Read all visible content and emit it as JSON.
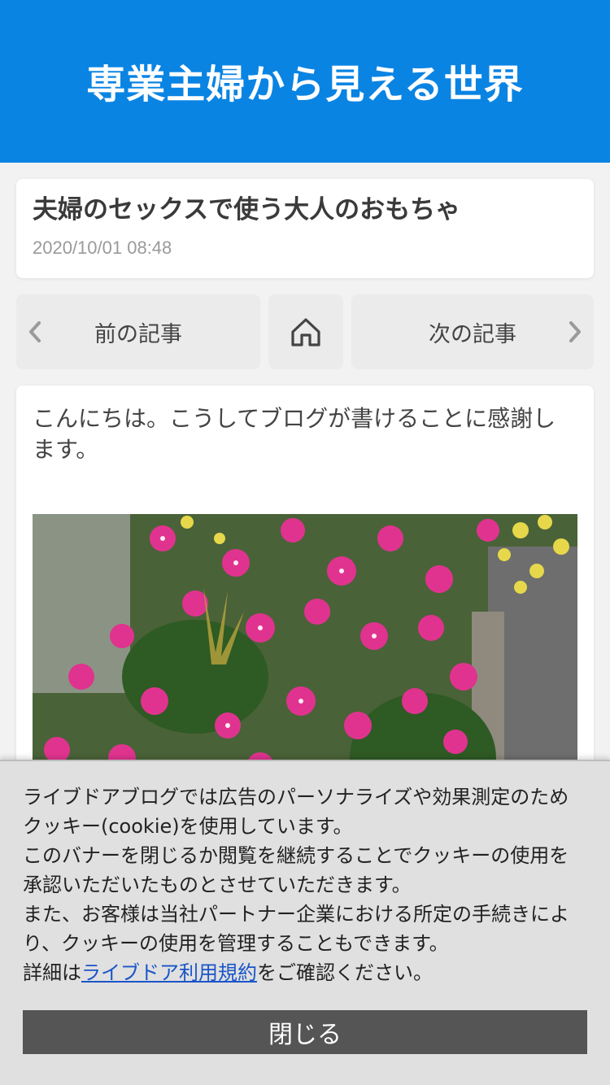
{
  "header": {
    "site_title": "専業主婦から見える世界",
    "background": "#0a84e3"
  },
  "article": {
    "title": "夫婦のセックスで使う大人のおもちゃ",
    "date": "2020/10/01 08:48",
    "body_paragraph": "こんにちは。こうしてブログが書けることに感謝します。"
  },
  "nav": {
    "prev_label": "前の記事",
    "next_label": "次の記事",
    "home_icon": "home-icon",
    "prev_icon": "chevron-left-icon",
    "next_icon": "chevron-right-icon"
  },
  "cookie": {
    "line1": "ライブドアブログでは広告のパーソナライズや効果測定のためクッキー(cookie)を使用しています。",
    "line2": "このバナーを閉じるか閲覧を継続することでクッキーの使用を承認いただいたものとさせていただきます。",
    "line3": "また、お客様は当社パートナー企業における所定の手続きにより、クッキーの使用を管理することもできます。",
    "detail_prefix": "詳細は",
    "detail_link": "ライブドア利用規約",
    "detail_suffix": "をご確認ください。",
    "close_label": "閉じる"
  }
}
